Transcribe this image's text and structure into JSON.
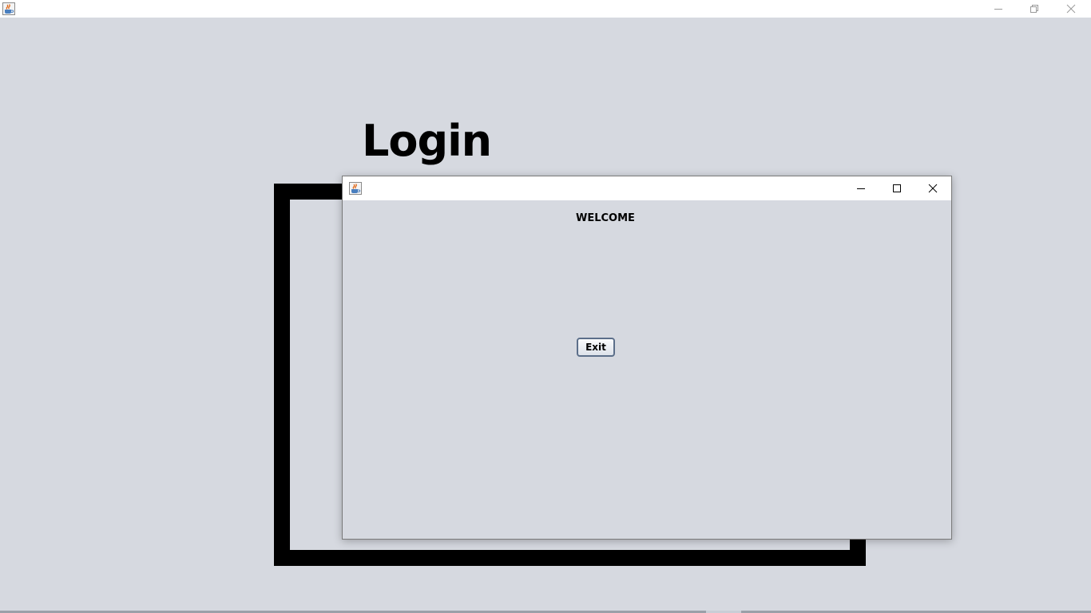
{
  "main_window": {
    "icon": "java-cup-icon",
    "controls": {
      "minimize": "minimize-icon",
      "restore": "restore-icon",
      "close": "close-icon"
    }
  },
  "login": {
    "title": "Login"
  },
  "dialog": {
    "icon": "java-cup-icon",
    "controls": {
      "minimize": "minimize-icon",
      "maximize": "maximize-icon",
      "close": "close-icon"
    },
    "welcome_text": "WELCOME",
    "exit_label": "Exit"
  },
  "colors": {
    "background": "#d6d9e0",
    "titlebar": "#ffffff",
    "frame_border": "#000000",
    "button_border": "#5c6f8a"
  }
}
